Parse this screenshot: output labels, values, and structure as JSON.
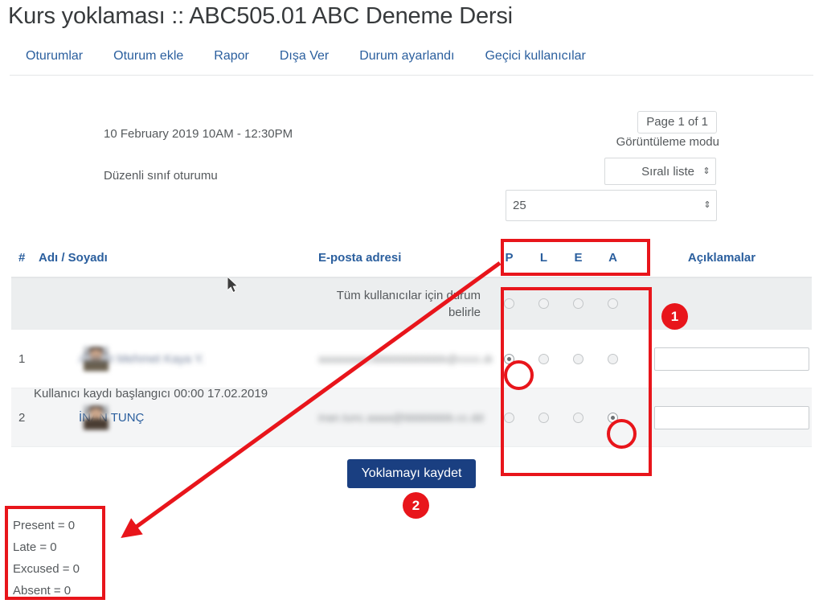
{
  "header": {
    "title": "Kurs yoklaması :: ABC505.01 ABC Deneme Dersi",
    "tabs": [
      {
        "label": "Oturumlar",
        "name": "tab-oturumlar"
      },
      {
        "label": "Oturum ekle",
        "name": "tab-oturum-ekle"
      },
      {
        "label": "Rapor",
        "name": "tab-rapor"
      },
      {
        "label": "Dışa Ver",
        "name": "tab-disa-ver"
      },
      {
        "label": "Durum ayarlandı",
        "name": "tab-durum-ayarlandi"
      },
      {
        "label": "Geçici kullanıcılar",
        "name": "tab-gecici-kullanicilar"
      }
    ]
  },
  "session": {
    "datetime": "10 February 2019 10AM - 12:30PM",
    "description": "Düzenli sınıf oturumu"
  },
  "controls": {
    "paging": "Page 1 of 1",
    "viewmode_label": "Görüntüleme modu",
    "viewmode_value": "Sıralı liste",
    "perpage_value": "25",
    "select_arrow": "⇕"
  },
  "table": {
    "columns": {
      "number": "#",
      "name": "Adı / Soyadı",
      "email": "E-posta adresi",
      "remark": "Açıklamalar"
    },
    "status_headers": [
      "P",
      "L",
      "E",
      "A"
    ],
    "all_users_label_line1": "Tüm kullanıcılar için durum",
    "all_users_label_line2": "belirle",
    "rows": [
      {
        "number": "1",
        "name_blurred": "Ahmet Mehmet Kaya Y.",
        "name_visible": "",
        "enrolment_note": "Kullanıcı kaydı başlangıcı 00:00 17.02.2019",
        "email_blurred": "aaaaaaaa.bbbbbbbbbbbb@cccc.dd",
        "selected_status": "P",
        "remark_value": "",
        "remark_placeholder": ""
      },
      {
        "number": "2",
        "name_blurred": "",
        "name_visible": "İNAN TUNÇ",
        "enrolment_note": "",
        "email_blurred": "inan.tunc.aaaa@bbbbbbbb.cc.dd",
        "selected_status": "A",
        "remark_value": "",
        "remark_placeholder": ""
      }
    ]
  },
  "actions": {
    "save_label": "Yoklamayı kaydet"
  },
  "legend": {
    "lines": [
      "Present = 0",
      "Late = 0",
      "Excused = 0",
      "Absent = 0"
    ]
  },
  "annotations": {
    "badge_1": "1",
    "badge_2": "2",
    "accent_color": "#e8151b"
  }
}
